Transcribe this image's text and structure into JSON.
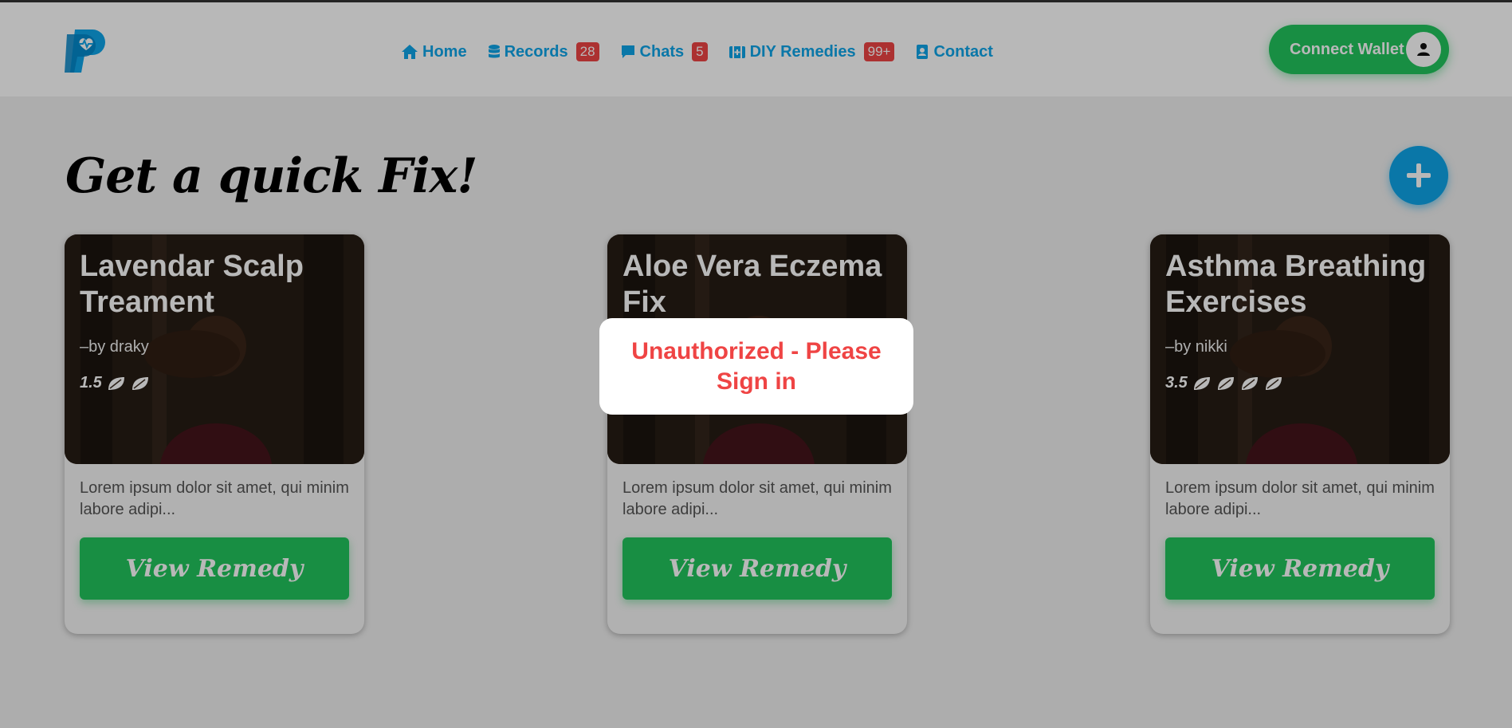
{
  "nav": {
    "home": {
      "label": "Home"
    },
    "records": {
      "label": "Records",
      "badge": "28"
    },
    "chats": {
      "label": "Chats",
      "badge": "5"
    },
    "remedies": {
      "label": "DIY Remedies",
      "badge": "99+"
    },
    "contact": {
      "label": "Contact"
    }
  },
  "wallet": {
    "label": "Connect Wallet"
  },
  "main": {
    "heading": "Get a quick Fix!"
  },
  "cards": [
    {
      "title": "Lavendar Scalp Treament",
      "author": "–by draky",
      "rating": "1.5",
      "desc": "Lorem ipsum dolor sit amet, qui minim labore adipi...",
      "button": "View Remedy"
    },
    {
      "title": "Aloe Vera Eczema Fix",
      "author": "",
      "rating": "",
      "desc": "Lorem ipsum dolor sit amet, qui minim labore adipi...",
      "button": "View Remedy"
    },
    {
      "title": "Asthma Breathing Exercises",
      "author": "–by nikki",
      "rating": "3.5",
      "desc": "Lorem ipsum dolor sit amet, qui minim labore adipi...",
      "button": "View Remedy"
    }
  ],
  "toast": {
    "message": "Unauthorized - Please Sign in"
  },
  "colors": {
    "primary": "#0ea5e9",
    "success": "#22c55e",
    "danger": "#ef4444"
  }
}
